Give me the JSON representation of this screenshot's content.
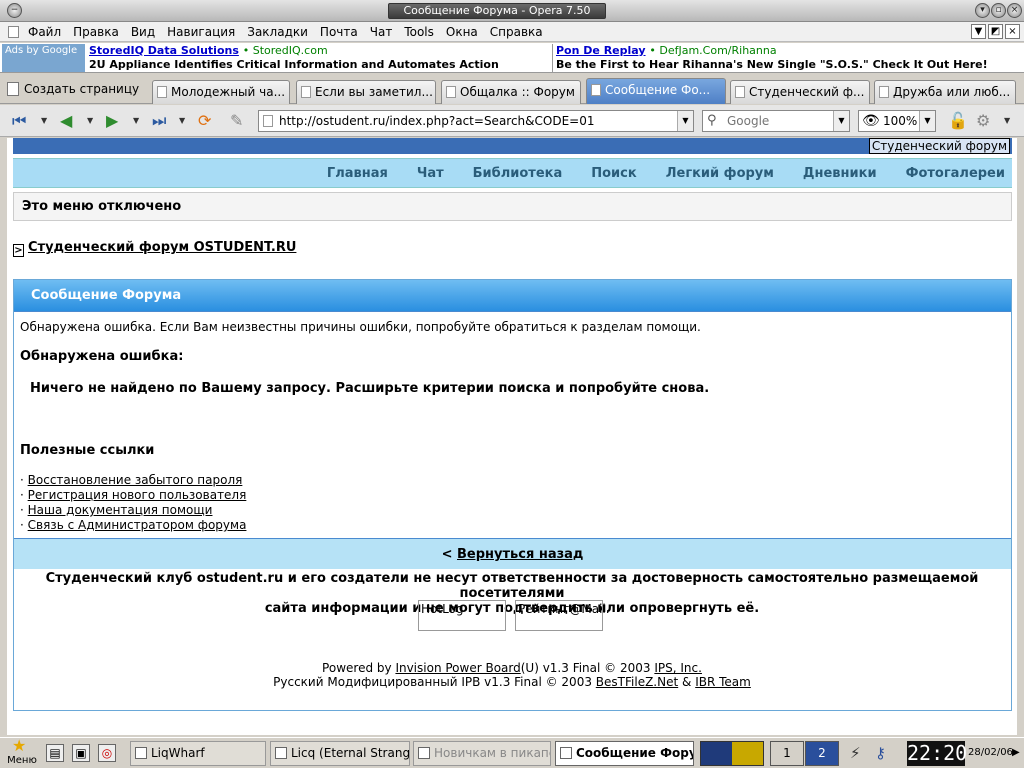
{
  "window": {
    "title": "Сообщение Форума - Opera 7.50"
  },
  "menu": {
    "items": [
      "Файл",
      "Правка",
      "Вид",
      "Навигация",
      "Закладки",
      "Почта",
      "Чат",
      "Tools",
      "Окна",
      "Справка"
    ]
  },
  "ads": {
    "label": "Ads by Google",
    "ad1": {
      "link": "StoredIQ Data Solutions",
      "url": "• StoredIQ.com",
      "text": "2U Appliance Identifies Critical Information and Automates Action"
    },
    "ad2": {
      "link": "Pon De Replay",
      "url": "• DefJam.Com/Rihanna",
      "text": "Be the First to Hear Rihanna's New Single \"S.O.S.\" Check It Out Here!"
    }
  },
  "tabs": {
    "new_tab": "Создать страницу",
    "items": [
      {
        "label": "Молодежный ча..."
      },
      {
        "label": "Если вы заметил..."
      },
      {
        "label": "Общалка :: Форум"
      },
      {
        "label": "Сообщение Фо..."
      },
      {
        "label": "Студенческий ф..."
      },
      {
        "label": "Дружба или люб..."
      }
    ]
  },
  "toolbar": {
    "url": "http://ostudent.ru/index.php?act=Search&CODE=01",
    "search_placeholder": "Google",
    "zoom": "100%"
  },
  "page": {
    "brand": "Студенческий форум",
    "nav": [
      "Главная",
      "Чат",
      "Библиотека",
      "Поиск",
      "Легкий форум",
      "Дневники",
      "Фотогалереи"
    ],
    "menu_disabled": "Это меню отключено",
    "breadcrumb_arrow": ">",
    "breadcrumb": "Студенческий форум OSTUDENT.RU",
    "box_title": "Сообщение Форума",
    "error_intro": "Обнаружена ошибка. Если Вам неизвестны причины ошибки, попробуйте обратиться к разделам помощи.",
    "error_title": "Обнаружена ошибка:",
    "error_message": "Ничего не найдено по Вашему запросу. Расширьте критерии поиска и попробуйте снова.",
    "useful_links_title": "Полезные ссылки",
    "links": [
      "Восстановление забытого пароля",
      "Регистрация нового пользователя",
      "Наша документация помощи",
      "Связь с Администратором форума"
    ],
    "back_prefix": "<",
    "back": "Вернуться назад",
    "disclaimer_line1": "Студенческий клуб ostudent.ru и его создатели не несут ответственности за достоверность самостоятельно размещаемой посетителями",
    "disclaimer_line2": "сайта информации и не могут подтвердить или опровергнуть её.",
    "counter1": "HotLog",
    "counter2": "Рейтинг@Mail.",
    "powered_prefix": "Powered by",
    "powered_link": "Invision Power Board",
    "powered_suffix": "(U) v1.3 Final © 2003",
    "powered_ips": "IPS, Inc.",
    "rus_prefix": "Русский Модифицированный IPB v1.3 Final © 2003",
    "rus_link1": "BesTFileZ.Net",
    "rus_amp": "&",
    "rus_link2": "IBR Team"
  },
  "taskbar": {
    "start": "Меню",
    "tasks": [
      {
        "label": "LiqWharf"
      },
      {
        "label": "Licq (Eternal Stranger)"
      },
      {
        "label": "Новичкам в пикапе. С"
      },
      {
        "label": "Сообщение Форума -"
      }
    ],
    "workspaces": [
      "1",
      "2"
    ],
    "clock": "22:20",
    "date": "28/02/06"
  }
}
